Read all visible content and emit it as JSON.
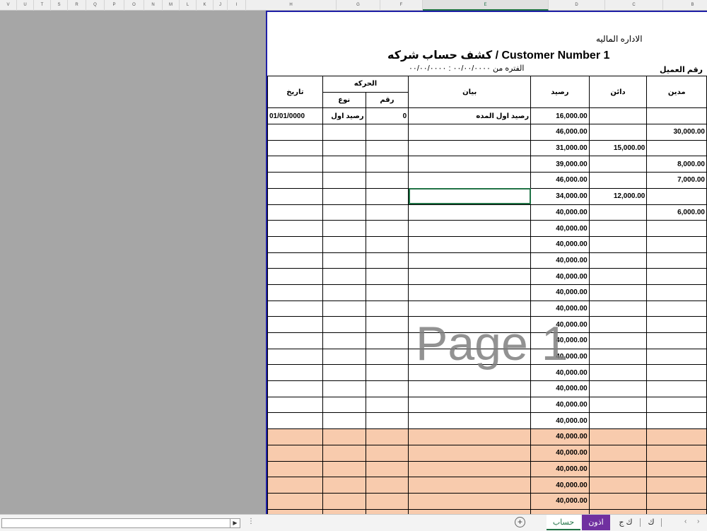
{
  "column_headers": [
    "V",
    "U",
    "T",
    "S",
    "R",
    "Q",
    "P",
    "O",
    "N",
    "M",
    "L",
    "K",
    "J",
    "I",
    "H",
    "G",
    "F",
    "E",
    "D",
    "C",
    "B"
  ],
  "report": {
    "department": "الاداره الماليه",
    "title": "كشف حساب شركه / Customer Number 1",
    "period": "الفتره من ٠٠/٠٠/٠٠٠٠ : ٠٠/٠٠/٠٠٠٠",
    "customer_no_label": "رقم العميل"
  },
  "table": {
    "headers": {
      "date": "تاريخ",
      "movement": "الحركه",
      "type": "نوع",
      "number": "رقم",
      "description": "بيان",
      "balance": "رصيد",
      "credit": "دائن",
      "debit": "مدين"
    },
    "rows": [
      {
        "date": "01/01/0000",
        "type": "رصيد اول",
        "number": "0",
        "description": "رصيد اول المده",
        "balance": "16,000.00",
        "credit": "",
        "debit": ""
      },
      {
        "date": "",
        "type": "",
        "number": "",
        "description": "",
        "balance": "46,000.00",
        "credit": "",
        "debit": "30,000.00"
      },
      {
        "date": "",
        "type": "",
        "number": "",
        "description": "",
        "balance": "31,000.00",
        "credit": "15,000.00",
        "debit": ""
      },
      {
        "date": "",
        "type": "",
        "number": "",
        "description": "",
        "balance": "39,000.00",
        "credit": "",
        "debit": "8,000.00"
      },
      {
        "date": "",
        "type": "",
        "number": "",
        "description": "",
        "balance": "46,000.00",
        "credit": "",
        "debit": "7,000.00"
      },
      {
        "date": "",
        "type": "",
        "number": "",
        "description": "",
        "balance": "34,000.00",
        "credit": "12,000.00",
        "debit": ""
      },
      {
        "date": "",
        "type": "",
        "number": "",
        "description": "",
        "balance": "40,000.00",
        "credit": "",
        "debit": "6,000.00"
      },
      {
        "date": "",
        "type": "",
        "number": "",
        "description": "",
        "balance": "40,000.00",
        "credit": "",
        "debit": ""
      },
      {
        "date": "",
        "type": "",
        "number": "",
        "description": "",
        "balance": "40,000.00",
        "credit": "",
        "debit": ""
      },
      {
        "date": "",
        "type": "",
        "number": "",
        "description": "",
        "balance": "40,000.00",
        "credit": "",
        "debit": ""
      },
      {
        "date": "",
        "type": "",
        "number": "",
        "description": "",
        "balance": "40,000.00",
        "credit": "",
        "debit": ""
      },
      {
        "date": "",
        "type": "",
        "number": "",
        "description": "",
        "balance": "40,000.00",
        "credit": "",
        "debit": ""
      },
      {
        "date": "",
        "type": "",
        "number": "",
        "description": "",
        "balance": "40,000.00",
        "credit": "",
        "debit": ""
      },
      {
        "date": "",
        "type": "",
        "number": "",
        "description": "",
        "balance": "40,000.00",
        "credit": "",
        "debit": ""
      },
      {
        "date": "",
        "type": "",
        "number": "",
        "description": "",
        "balance": "40,000.00",
        "credit": "",
        "debit": ""
      },
      {
        "date": "",
        "type": "",
        "number": "",
        "description": "",
        "balance": "40,000.00",
        "credit": "",
        "debit": ""
      },
      {
        "date": "",
        "type": "",
        "number": "",
        "description": "",
        "balance": "40,000.00",
        "credit": "",
        "debit": ""
      },
      {
        "date": "",
        "type": "",
        "number": "",
        "description": "",
        "balance": "40,000.00",
        "credit": "",
        "debit": ""
      },
      {
        "date": "",
        "type": "",
        "number": "",
        "description": "",
        "balance": "40,000.00",
        "credit": "",
        "debit": ""
      },
      {
        "date": "",
        "type": "",
        "number": "",
        "description": "",
        "balance": "40,000.00",
        "credit": "",
        "debit": ""
      },
      {
        "date": "",
        "type": "",
        "number": "",
        "description": "",
        "balance": "40,000.00",
        "credit": "",
        "debit": ""
      },
      {
        "date": "",
        "type": "",
        "number": "",
        "description": "",
        "balance": "40,000.00",
        "credit": "",
        "debit": ""
      },
      {
        "date": "",
        "type": "",
        "number": "",
        "description": "",
        "balance": "40,000.00",
        "credit": "",
        "debit": ""
      },
      {
        "date": "",
        "type": "",
        "number": "",
        "description": "",
        "balance": "40,000.00",
        "credit": "",
        "debit": ""
      },
      {
        "date": "",
        "type": "",
        "number": "",
        "description": "",
        "balance": "40,000.00",
        "credit": "",
        "debit": ""
      },
      {
        "date": "",
        "type": "",
        "number": "",
        "description": "",
        "balance": "40,000.00",
        "credit": "",
        "debit": ""
      }
    ],
    "peach_fill_color": "#f8cbad",
    "peach_rows_from": 20
  },
  "watermark": "Page 1",
  "sheet_tabs": [
    "حساب",
    "اذون",
    "ك ج",
    "ك"
  ],
  "active_tab": "حساب",
  "purple_tab": "اذون",
  "colors": {
    "accent": "#217346",
    "purple_tab": "#7030a0",
    "page_border": "#1f1fa6"
  }
}
